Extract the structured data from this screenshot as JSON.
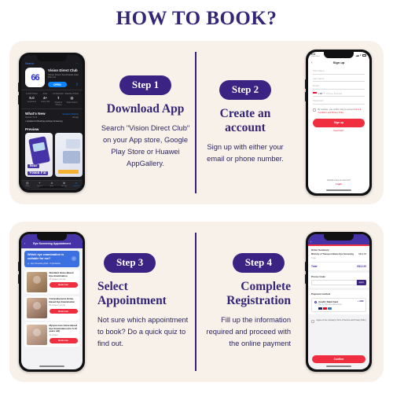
{
  "header": {
    "title": "HOW TO BOOK?"
  },
  "theme": {
    "page_bg": "#ffffff",
    "panel_bg": "#f8f1e9",
    "accent_navy": "#342578",
    "pill_purple": "#3b2383",
    "button_red": "#ef2e3f",
    "app_purple": "#4733a8",
    "quiz_blue": "#3c6fe0"
  },
  "steps": [
    {
      "pill": "Step 1",
      "title": "Download App",
      "description": "Search \"Vision Direct Club\" on your App store, Google Play Store or Huawei AppGallery."
    },
    {
      "pill": "Step 2",
      "title": "Create an account",
      "description": "Sign up with either your email or phone number."
    },
    {
      "pill": "Step 3",
      "title": "Select Appointment",
      "description": "Not sure which appointment to book? Do a quick quiz to find out."
    },
    {
      "pill": "Step 4",
      "title": "Complete Registration",
      "description": "Fill up the information required and proceed with the online payment"
    }
  ],
  "phone_store": {
    "back_label": "Search",
    "app_icon_glyph": "66",
    "app_name": "Vision Direct Club",
    "app_developer": "Vision Direct South East Asia Pte Ltd",
    "open_button": "OPEN",
    "share_icon": "share-icon",
    "stats": [
      {
        "key": "5 RATINGS",
        "value": "5.0",
        "sub": "★★★★★"
      },
      {
        "key": "AGE",
        "value": "4+",
        "sub": "Years Old"
      },
      {
        "key": "CATEGORY",
        "value": "⚕",
        "sub": "Health & Fitness"
      },
      {
        "key": "DEVELOPER",
        "value": "◎",
        "sub": "Vision Direct"
      }
    ],
    "whats_new_title": "What's New",
    "version_history_link": "Version History",
    "version": "Version 1.0.0",
    "version_age": "2d ago",
    "release_note": "• Updated UI Booking and Eye Screening",
    "preview_title": "Preview",
    "preview_tag_line1": "Your",
    "preview_tag_line2": "Vision Pal",
    "tabs": [
      {
        "icon": "today-icon",
        "label": "Today"
      },
      {
        "icon": "games-icon",
        "label": "Games"
      },
      {
        "icon": "apps-icon",
        "label": "Apps"
      },
      {
        "icon": "arcade-icon",
        "label": "Arcade"
      },
      {
        "icon": "search-icon",
        "label": "Search"
      }
    ]
  },
  "phone_signup": {
    "status_time": "9:53",
    "status_carrier": "Vision Direct",
    "back_icon": "chevron-left-icon",
    "title": "Sign up",
    "fields": [
      {
        "placeholder": "First Name",
        "value": ""
      },
      {
        "placeholder": "Last Name",
        "value": ""
      },
      {
        "placeholder": "Email",
        "value": ""
      },
      {
        "placeholder": "Phone Number",
        "value": "",
        "country_code": "+65"
      },
      {
        "placeholder": "Password",
        "value": ""
      }
    ],
    "terms_prefix": "By continue, you confirm that you accept",
    "terms_link": "Terms & Conditions and Privacy Policy",
    "submit_button": "Sign up",
    "need_help_link": "Need help?",
    "footer_question": "Already have an account?",
    "footer_link": "Login"
  },
  "phone_appointment": {
    "back_icon": "chevron-left-icon",
    "title": "Eye Screening Appointment",
    "quiz": {
      "title": "Which eye examination is suitable for me?",
      "meta_icon": "pin-icon",
      "meta": "Eye Screening Quiz  •  4 Questions",
      "arrow_icon": "chevron-right-icon"
    },
    "appointments": [
      {
        "title": "Standard Home-Based Eye Examination",
        "meta": "45 minutes | per pax",
        "button": "Book now"
      },
      {
        "title": "Comprehensive Home-Based Eye Examination",
        "meta": "60 minutes | per pax",
        "button": "Book now"
      },
      {
        "title": "Myopia Care Home-Based Eye Examination (for 6-16 years old)",
        "meta": "30 minutes",
        "button": "Book now"
      }
    ]
  },
  "phone_payment": {
    "order_summary_title": "Order Summary",
    "item_name": "Ministry of Transport Basic Eye Screening",
    "item_price": "S$12.00",
    "item_qty": "1 pax",
    "total_label": "Total",
    "total_value": "S$12.00",
    "promo_label": "Promo Code",
    "promo_placeholder": "",
    "promo_button": "Apply",
    "payment_method_title": "Payment method",
    "card_title": "Credit / Debit Card",
    "card_sub": "Pay by Visa and MasterCard",
    "card_add_link": "+ ADD",
    "terms_text": "I agree to the company's Term of Service and Privacy Policy",
    "confirm_button": "Confirm"
  }
}
